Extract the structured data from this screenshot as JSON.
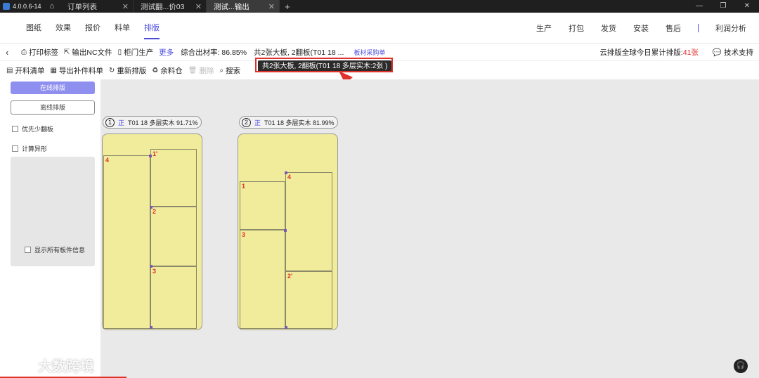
{
  "titlebar": {
    "version": "4.0.0.6-14",
    "tabs": [
      {
        "label": "订单列表",
        "active": false
      },
      {
        "label": "测试翻...价03",
        "active": false
      },
      {
        "label": "测试...输出",
        "active": true
      }
    ],
    "add_tab": "+",
    "window_controls": {
      "minimize": "—",
      "maximize": "❐",
      "close": "✕"
    }
  },
  "menubar": {
    "left": [
      {
        "label": "图纸",
        "active": false
      },
      {
        "label": "效果",
        "active": false
      },
      {
        "label": "报价",
        "active": false
      },
      {
        "label": "料单",
        "active": false
      },
      {
        "label": "排版",
        "active": true
      }
    ],
    "right": [
      "生产",
      "打包",
      "发货",
      "安装",
      "售后",
      "利润分析"
    ]
  },
  "toolbar1": {
    "back_icon": "‹",
    "print_label": "打印标签",
    "nc_label": "输出NC文件",
    "door_label": "柜门生产",
    "more_label": "更多",
    "utilization": "综合出材率: 86.85%",
    "boards_summary": "共2张大板, 2翻板(T01 18 ...",
    "purchase_link": "板材采购单",
    "cloud_prefix": "云排版全球今日累计排版: ",
    "cloud_count": "41张",
    "support_label": "技术支持"
  },
  "toolbar2": {
    "cut_list": "开料清单",
    "export_supplement": "导出补件料单",
    "re_layout": "重新排版",
    "remnant": "余料仓",
    "delete": "删除",
    "search": "搜索"
  },
  "tooltip": "共2张大板, 2翻板(T01 18 多层实木:2张 )",
  "sidebar": {
    "online_btn": "在线排版",
    "offline_btn": "离线排版",
    "opt_flip": "优先少翻板",
    "opt_irregular": "计算异形",
    "show_all_info": "显示所有板件信息"
  },
  "sheets": [
    {
      "index": "1",
      "side": "正",
      "material": "T01 18 多层实木 91.71%",
      "part_labels": [
        "4",
        "1'",
        "2",
        "3"
      ]
    },
    {
      "index": "2",
      "side": "正",
      "material": "T01 18 多层实木 81.99%",
      "part_labels": [
        "1",
        "4",
        "3",
        "2'"
      ]
    }
  ],
  "watermark": "大数跨境",
  "colors": {
    "accent": "#4b4bdc",
    "highlight": "#e0312a",
    "sheet": "#f1ec9c"
  }
}
